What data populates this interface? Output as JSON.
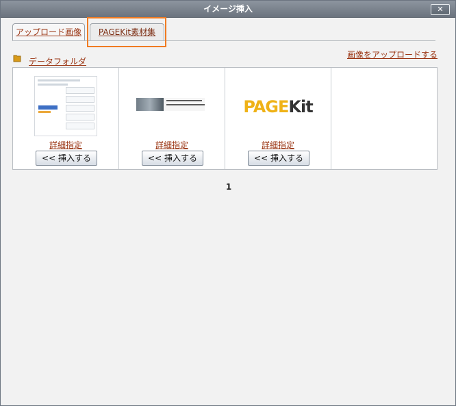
{
  "dialog": {
    "title": "イメージ挿入",
    "close_label": "✕"
  },
  "tabs": [
    {
      "label": "アップロード画像"
    },
    {
      "label": "PAGEKit素材集"
    }
  ],
  "folder": {
    "label": "データフォルダ"
  },
  "upload_link": "画像をアップロードする",
  "thumbnails": [
    {
      "detail_label": "詳細指定",
      "insert_label": "<< 挿入する"
    },
    {
      "detail_label": "詳細指定",
      "insert_label": "<< 挿入する"
    },
    {
      "detail_label": "詳細指定",
      "insert_label": "<< 挿入する"
    }
  ],
  "pagination": {
    "current": "1"
  },
  "colors": {
    "accent": "#f07b22",
    "link": "#9a3412"
  }
}
